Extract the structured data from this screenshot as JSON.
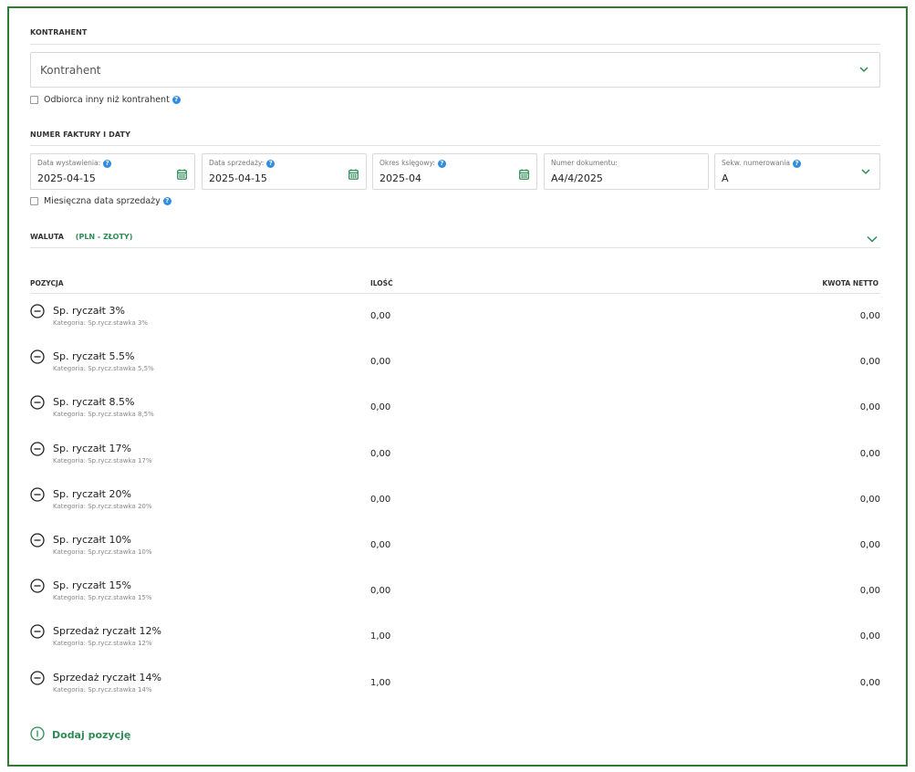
{
  "contractor": {
    "section_title": "KONTRAHENT",
    "select_placeholder": "Kontrahent",
    "recipient_checkbox_label": "Odbiorca inny niż kontrahent"
  },
  "invoice": {
    "section_title": "NUMER FAKTURY I DATY",
    "fields": [
      {
        "label": "Data wystawienia:",
        "value": "2025-04-15",
        "icon": "calendar-icon",
        "info": true
      },
      {
        "label": "Data sprzedaży:",
        "value": "2025-04-15",
        "icon": "calendar-icon",
        "info": true
      },
      {
        "label": "Okres księgowy:",
        "value": "2025-04",
        "icon": "calendar-icon",
        "info": true
      },
      {
        "label": "Numer dokumentu:",
        "value": "A4/4/2025",
        "icon": "",
        "info": false
      },
      {
        "label": "Sekw. numerowania",
        "value": "A",
        "icon": "chevron-down-icon",
        "info": true
      }
    ],
    "monthly_checkbox_label": "Miesięczna data sprzedaży"
  },
  "currency": {
    "label": "WALUTA",
    "value": "(PLN - ZŁOTY)"
  },
  "positions": {
    "headers": {
      "position": "POZYCJA",
      "quantity": "ILOŚĆ",
      "net_amount": "KWOTA NETTO"
    },
    "rows": [
      {
        "name": "Sp. ryczałt 3%",
        "category": "Kategoria: Sp.rycz.stawka 3%",
        "quantity": "0,00",
        "net": "0,00"
      },
      {
        "name": "Sp. ryczałt 5.5%",
        "category": "Kategoria: Sp.rycz.stawka 5,5%",
        "quantity": "0,00",
        "net": "0,00"
      },
      {
        "name": "Sp. ryczałt 8.5%",
        "category": "Kategoria: Sp.rycz.stawka 8,5%",
        "quantity": "0,00",
        "net": "0,00"
      },
      {
        "name": "Sp. ryczałt 17%",
        "category": "Kategoria: Sp.rycz.stawka 17%",
        "quantity": "0,00",
        "net": "0,00"
      },
      {
        "name": "Sp. ryczałt 20%",
        "category": "Kategoria: Sp.rycz.stawka 20%",
        "quantity": "0,00",
        "net": "0,00"
      },
      {
        "name": "Sp. ryczałt 10%",
        "category": "Kategoria: Sp.rycz.stawka 10%",
        "quantity": "0,00",
        "net": "0,00"
      },
      {
        "name": "Sp. ryczałt 15%",
        "category": "Kategoria: Sp.rycz.stawka 15%",
        "quantity": "0,00",
        "net": "0,00"
      },
      {
        "name": "Sprzedaż ryczałt 12%",
        "category": "Kategoria: Sp.rycz.stawka 12%",
        "quantity": "1,00",
        "net": "0,00"
      },
      {
        "name": "Sprzedaż ryczałt 14%",
        "category": "Kategoria: Sp.rycz.stawka 14%",
        "quantity": "1,00",
        "net": "0,00"
      }
    ],
    "add_label": "Dodaj pozycję"
  },
  "colors": {
    "accent": "#2e8b57",
    "info": "#2f8ce0",
    "border": "#2e7d32"
  }
}
